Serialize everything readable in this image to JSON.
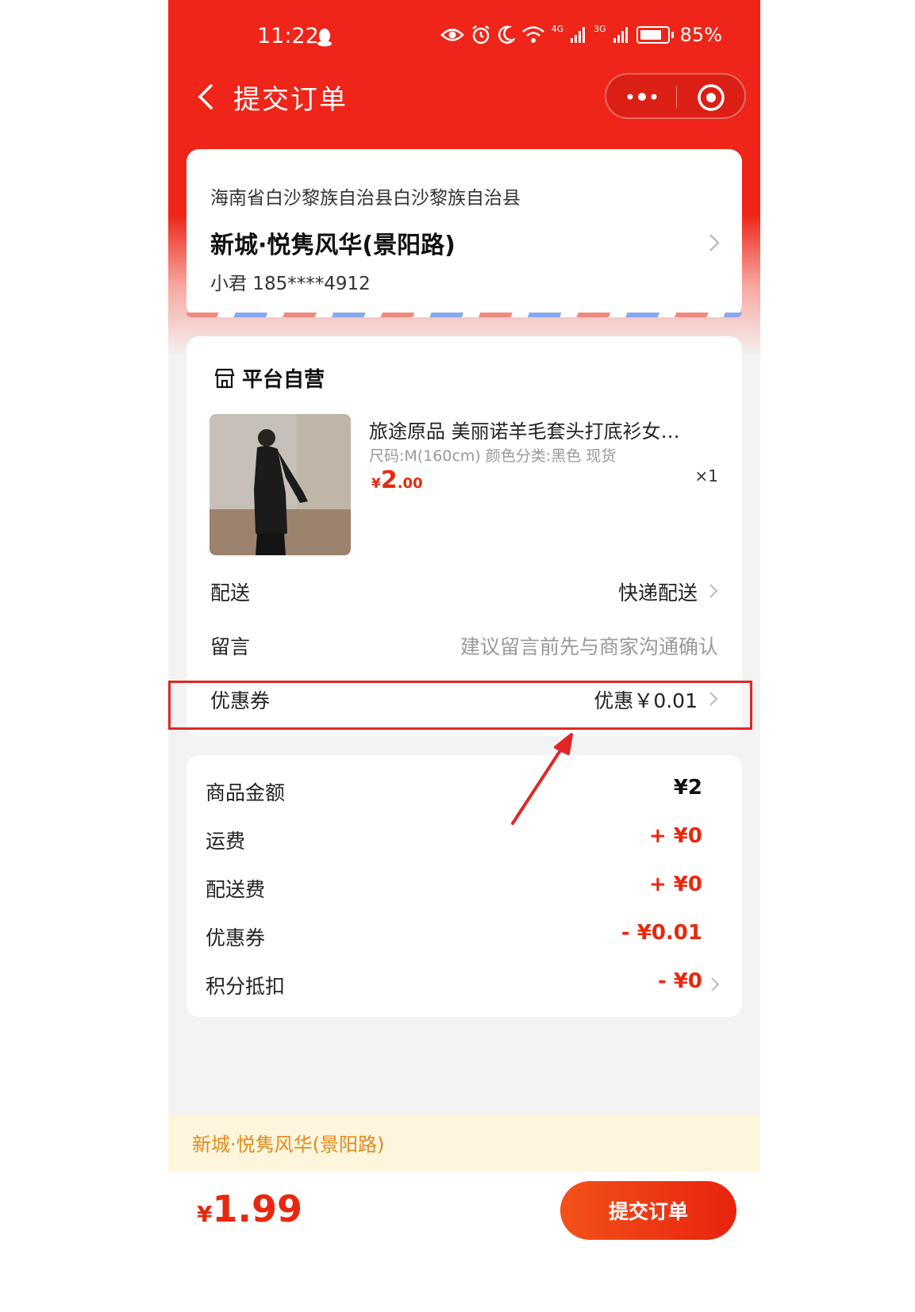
{
  "status_bar": {
    "time": "11:22",
    "network_1": "4G",
    "network_2": "3G",
    "battery": "85%"
  },
  "nav": {
    "title": "提交订单"
  },
  "address": {
    "region": "海南省白沙黎族自治县白沙黎族自治县",
    "detail": "新城·悦隽风华(景阳路)",
    "contact": "小君  185****4912"
  },
  "order": {
    "shop_name": "平台自营",
    "product": {
      "title": "旅途原品 美丽诺羊毛套头打底衫女…",
      "spec": "尺码:M(160cm)  颜色分类:黑色 现货",
      "price_currency": "¥",
      "price_int": "2",
      "price_dec": ".00",
      "qty": "×1"
    },
    "delivery": {
      "label": "配送",
      "value": "快递配送"
    },
    "message": {
      "label": "留言",
      "placeholder": "建议留言前先与商家沟通确认"
    },
    "coupon": {
      "label": "优惠券",
      "value": "优惠￥0.01"
    }
  },
  "summary": {
    "items": [
      {
        "label": "商品金额",
        "value": "¥2"
      },
      {
        "label": "运费",
        "value": "+ ¥0"
      },
      {
        "label": "配送费",
        "value": "+ ¥0"
      },
      {
        "label": "优惠券",
        "value": "- ¥0.01"
      },
      {
        "label": "积分抵扣",
        "value": "- ¥0"
      }
    ]
  },
  "notice": "新城·悦隽风华(景阳路)",
  "footer": {
    "currency": "¥",
    "total": "1.99",
    "submit_label": "提交订单"
  },
  "colors": {
    "brand_red": "#ee2518",
    "price_red": "#e8280e",
    "notice_text": "#e18b1f",
    "highlight": "#e32525"
  }
}
